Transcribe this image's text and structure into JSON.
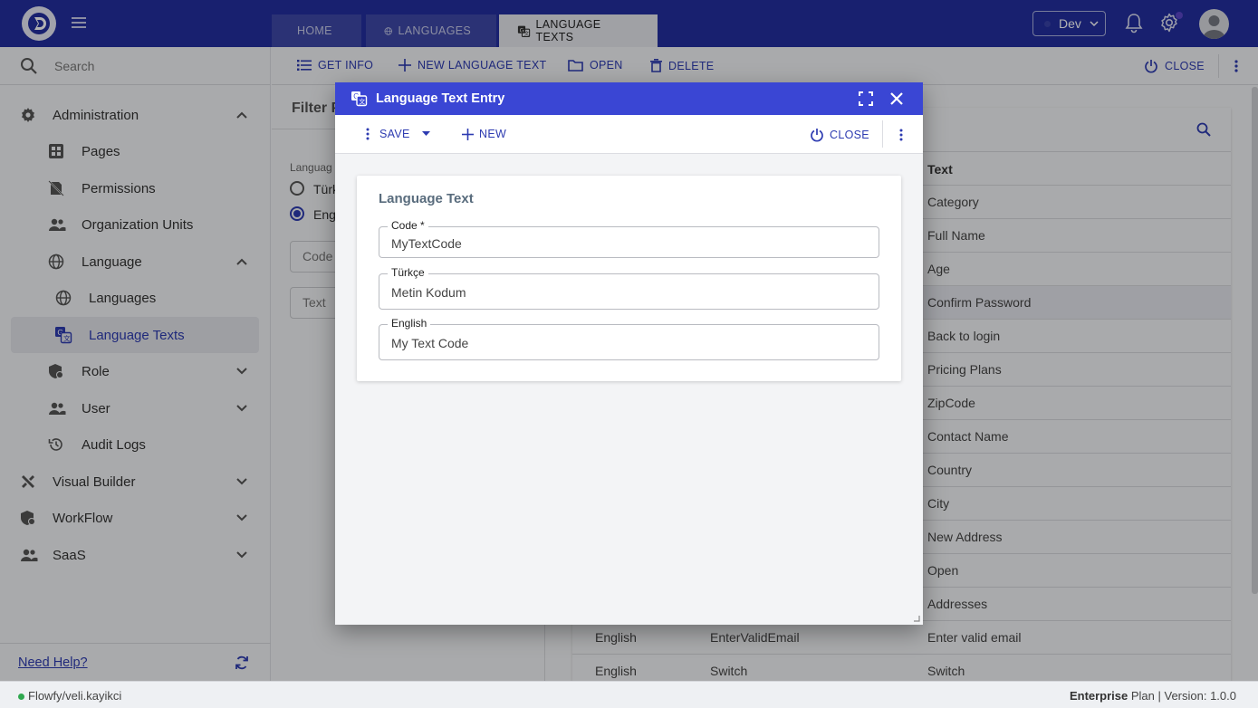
{
  "topbar": {
    "tabs": [
      "HOME",
      "LANGUAGES",
      "LANGUAGE TEXTS"
    ],
    "env": "Dev",
    "accent": "#232fa0"
  },
  "sidebar": {
    "search_placeholder": "Search",
    "items": [
      {
        "label": "Administration",
        "icon": "gear-icon"
      },
      {
        "label": "Pages",
        "icon": "pages-icon"
      },
      {
        "label": "Permissions",
        "icon": "permissions-icon"
      },
      {
        "label": "Organization Units",
        "icon": "people-icon"
      },
      {
        "label": "Language",
        "icon": "globe-icon"
      },
      {
        "label": "Languages",
        "icon": "globe-icon"
      },
      {
        "label": "Language Texts",
        "icon": "translate-icon"
      },
      {
        "label": "Role",
        "icon": "role-icon"
      },
      {
        "label": "User",
        "icon": "people-icon"
      },
      {
        "label": "Audit Logs",
        "icon": "history-icon"
      },
      {
        "label": "Visual Builder",
        "icon": "tools-icon"
      },
      {
        "label": "WorkFlow",
        "icon": "workflow-icon"
      },
      {
        "label": "SaaS",
        "icon": "people-icon"
      }
    ],
    "help": "Need Help?"
  },
  "toolbar": {
    "get_info": "GET INFO",
    "new_text": "NEW LANGUAGE TEXT",
    "open": "OPEN",
    "delete": "DELETE",
    "close": "CLOSE"
  },
  "filter": {
    "title": "Filter P",
    "lang_label": "Languag",
    "opt1": "Türk",
    "opt2": "Eng",
    "code_placeholder": "Code",
    "text_placeholder": "Text"
  },
  "table": {
    "header_text": "Text",
    "rows": [
      {
        "lang": "",
        "code": "",
        "text": "Category"
      },
      {
        "lang": "",
        "code": "",
        "text": "Full Name"
      },
      {
        "lang": "",
        "code": "",
        "text": "Age"
      },
      {
        "lang": "",
        "code": "",
        "text": "Confirm Password"
      },
      {
        "lang": "",
        "code": "",
        "text": "Back to login"
      },
      {
        "lang": "",
        "code": "",
        "text": "Pricing Plans"
      },
      {
        "lang": "",
        "code": "",
        "text": "ZipCode"
      },
      {
        "lang": "",
        "code": "",
        "text": "Contact Name"
      },
      {
        "lang": "",
        "code": "",
        "text": "Country"
      },
      {
        "lang": "",
        "code": "",
        "text": "City"
      },
      {
        "lang": "",
        "code": "",
        "text": "New Address"
      },
      {
        "lang": "",
        "code": "",
        "text": "Open"
      },
      {
        "lang": "",
        "code": "",
        "text": "Addresses"
      },
      {
        "lang": "English",
        "code": "EnterValidEmail",
        "text": "Enter valid email"
      },
      {
        "lang": "English",
        "code": "Switch",
        "text": "Switch"
      }
    ]
  },
  "modal": {
    "title": "Language Text Entry",
    "save": "SAVE",
    "new": "NEW",
    "close": "CLOSE",
    "card_title": "Language Text",
    "fields": [
      {
        "label": "Code *",
        "value": "MyTextCode"
      },
      {
        "label": "Türkçe",
        "value": "Metin Kodum"
      },
      {
        "label": "English",
        "value": "My Text Code"
      }
    ]
  },
  "status": {
    "path": "Flowfy/veli.kayikci",
    "plan_bold": "Enterprise",
    "plan_rest": " Plan | Version: 1.0.0"
  }
}
